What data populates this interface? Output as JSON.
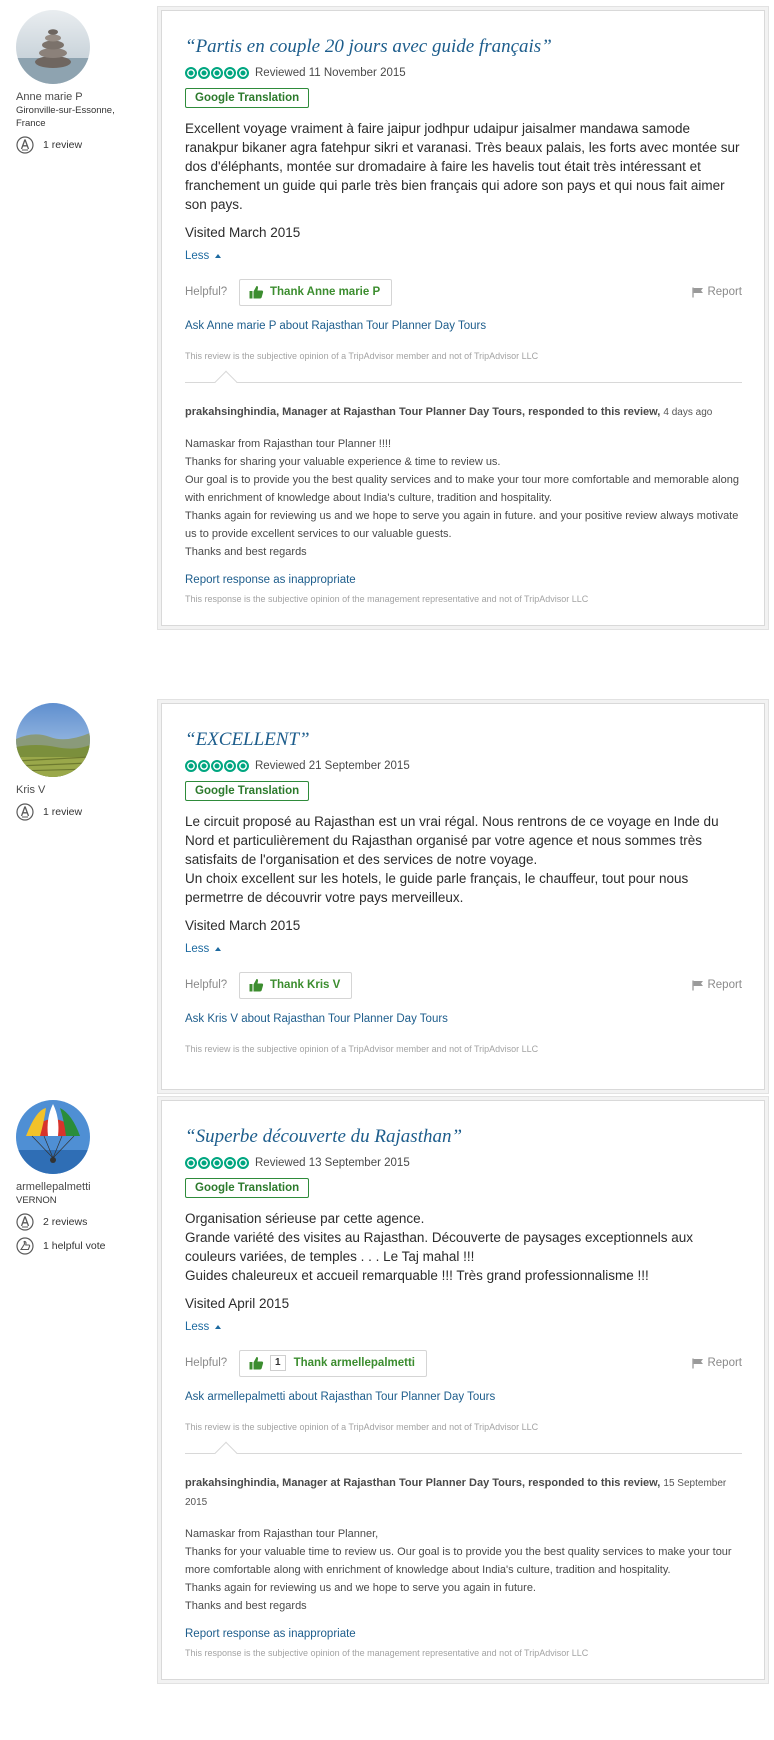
{
  "colors": {
    "link": "#1d5d8c",
    "bubble": "#00a680",
    "thank": "#3c8d2f",
    "translate_border": "#2e8b3a"
  },
  "reviews": [
    {
      "member": {
        "name": "Anne marie P",
        "location": "Gironville-sur-Essonne, France",
        "avatar_icon": "stacked-stones-photo",
        "badges": [
          {
            "icon": "reviewer-badge-icon",
            "label": "1 review"
          }
        ]
      },
      "title": "“Partis en couple 20 jours avec guide français”",
      "rating": 5,
      "reviewed": "Reviewed 11 November 2015",
      "translate_label": "Google Translation",
      "text": "Excellent voyage vraiment à faire jaipur jodhpur udaipur jaisalmer mandawa samode ranakpur bikaner agra fatehpur sikri et varanasi. Très beaux palais, les forts avec montée sur dos d'éléphants, montée sur dromadaire à faire les havelis tout était très intéressant et franchement un guide qui parle très bien français qui adore son pays et qui nous fait aimer son pays.",
      "visited": "Visited March 2015",
      "less_label": "Less",
      "helpful_label": "Helpful?",
      "thank_count": "",
      "thank_label": "Thank Anne marie P",
      "report_label": "Report",
      "ask_label": "Ask Anne marie P about Rajasthan Tour Planner Day Tours",
      "disclaimer": "This review is the subjective opinion of a TripAdvisor member and not of TripAdvisor LLC",
      "response": {
        "author": "prakahsinghindia, Manager at Rajasthan Tour Planner Day Tours, responded to this review,",
        "date": "4 days ago",
        "lines": [
          "Namaskar from Rajasthan tour Planner !!!!",
          "Thanks for sharing your valuable experience & time to review us.",
          "Our goal is to provide you the best quality services and to make your tour more comfortable and memorable along with enrichment of knowledge about India's culture, tradition and hospitality.",
          "Thanks again for reviewing us and we hope to serve you again in future. and your positive review always motivate us to provide excellent services to our valuable guests.",
          "Thanks and best regards"
        ],
        "report_label": "Report response as inappropriate",
        "disclaimer": "This response is the subjective opinion of the management representative and not of TripAdvisor LLC"
      }
    },
    {
      "member": {
        "name": "Kris V",
        "location": "",
        "avatar_icon": "vineyard-landscape-photo",
        "badges": [
          {
            "icon": "reviewer-badge-icon",
            "label": "1 review"
          }
        ]
      },
      "title": "“EXCELLENT”",
      "rating": 5,
      "reviewed": "Reviewed 21 September 2015",
      "translate_label": "Google Translation",
      "text": "Le circuit proposé au Rajasthan est un vrai régal. Nous rentrons de ce voyage en Inde du Nord et particulièrement du Rajasthan organisé par votre agence et nous sommes très satisfaits de l'organisation et des services de notre voyage.\nUn choix excellent sur les hotels, le guide parle français, le chauffeur, tout pour nous permetrre de découvrir votre pays merveilleux.",
      "visited": "Visited March 2015",
      "less_label": "Less",
      "helpful_label": "Helpful?",
      "thank_count": "",
      "thank_label": "Thank Kris V",
      "report_label": "Report",
      "ask_label": "Ask Kris V about Rajasthan Tour Planner Day Tours",
      "disclaimer": "This review is the subjective opinion of a TripAdvisor member and not of TripAdvisor LLC"
    },
    {
      "member": {
        "name": "armellepalmetti",
        "location": "VERNON",
        "avatar_icon": "parasail-photo",
        "badges": [
          {
            "icon": "reviewer-badge-icon",
            "label": "2 reviews"
          },
          {
            "icon": "helpful-vote-icon",
            "label": "1 helpful vote"
          }
        ]
      },
      "title": "“Superbe découverte du Rajasthan”",
      "rating": 5,
      "reviewed": "Reviewed 13 September 2015",
      "translate_label": "Google Translation",
      "text": "Organisation sérieuse par cette agence.\nGrande variété des visites au Rajasthan. Découverte de paysages exceptionnels aux couleurs variées, de temples . . . Le Taj mahal !!!\nGuides chaleureux et accueil remarquable !!! Très grand professionnalisme !!!",
      "visited": "Visited April 2015",
      "less_label": "Less",
      "helpful_label": "Helpful?",
      "thank_count": "1",
      "thank_label": "Thank armellepalmetti",
      "report_label": "Report",
      "ask_label": "Ask armellepalmetti about Rajasthan Tour Planner Day Tours",
      "disclaimer": "This review is the subjective opinion of a TripAdvisor member and not of TripAdvisor LLC",
      "response": {
        "author": "prakahsinghindia, Manager at Rajasthan Tour Planner Day Tours, responded to this review,",
        "date": "15 September 2015",
        "lines": [
          "Namaskar from Rajasthan tour Planner,",
          "Thanks for your valuable time to review us. Our goal is to provide you the best quality services to make your tour more comfortable along with enrichment of knowledge about India's culture, tradition and hospitality.",
          "Thanks again for reviewing us and we hope to serve you again in future.",
          "Thanks and best regards"
        ],
        "report_label": "Report response as inappropriate",
        "disclaimer": "This response is the subjective opinion of the management representative and not of TripAdvisor LLC"
      }
    }
  ]
}
